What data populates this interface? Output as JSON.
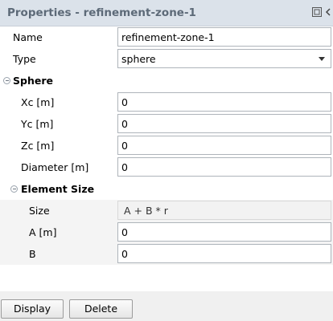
{
  "window": {
    "title": "Properties - refinement-zone-1"
  },
  "general": {
    "name_label": "Name",
    "name_value": "refinement-zone-1",
    "type_label": "Type",
    "type_value": "sphere"
  },
  "sphere": {
    "header": "Sphere",
    "xc_label": "Xc [m]",
    "xc_value": "0",
    "yc_label": "Yc [m]",
    "yc_value": "0",
    "zc_label": "Zc [m]",
    "zc_value": "0",
    "diameter_label": "Diameter [m]",
    "diameter_value": "0"
  },
  "element_size": {
    "header": "Element Size",
    "size_label": "Size",
    "size_value": "A + B * r",
    "a_label": "A [m]",
    "a_value": "0",
    "b_label": "B",
    "b_value": "0"
  },
  "buttons": {
    "display": "Display",
    "delete": "Delete"
  },
  "icons": {
    "dock": "dock-icon",
    "collapse": "chevron-left-icon"
  }
}
